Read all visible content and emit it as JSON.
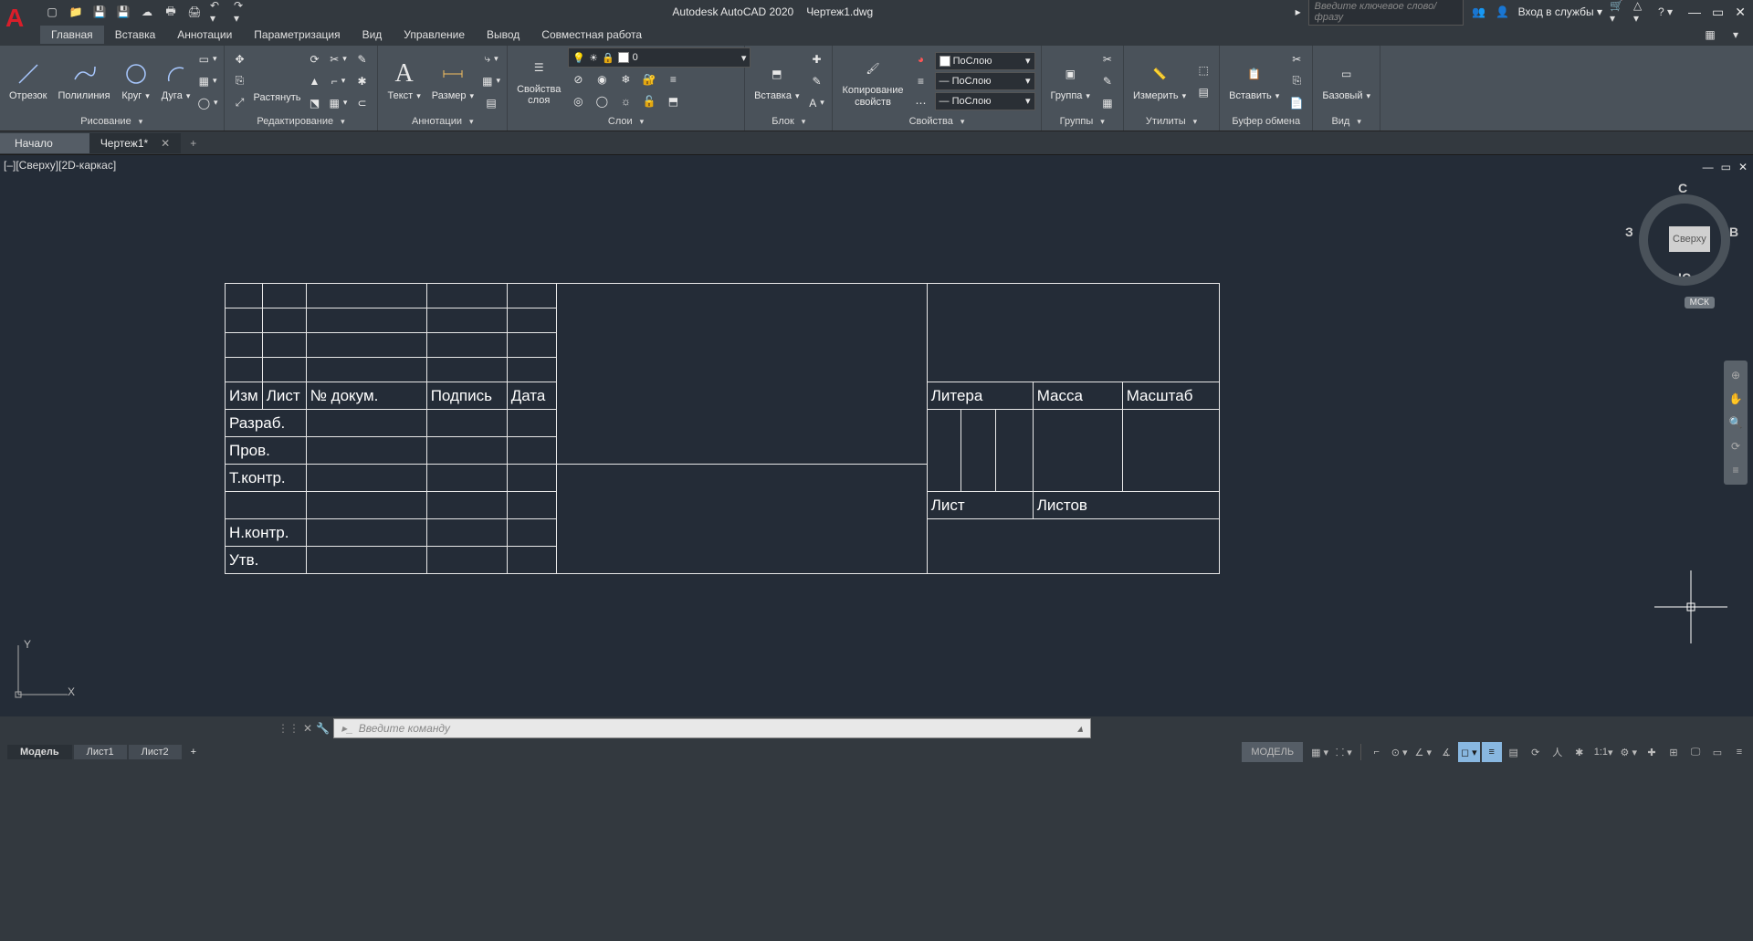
{
  "title": {
    "app": "Autodesk AutoCAD 2020",
    "file": "Чертеж1.dwg"
  },
  "search": {
    "placeholder": "Введите ключевое слово/фразу",
    "login": "Вход в службы"
  },
  "tabs": {
    "list": [
      "Главная",
      "Вставка",
      "Аннотации",
      "Параметризация",
      "Вид",
      "Управление",
      "Вывод",
      "Совместная работа"
    ],
    "active": 0
  },
  "ribbon": {
    "draw": {
      "line": "Отрезок",
      "pline": "Полилиния",
      "circle": "Круг",
      "arc": "Дуга",
      "panel": "Рисование"
    },
    "edit": {
      "stretch": "Растянуть",
      "panel": "Редактирование"
    },
    "annot": {
      "text": "Текст",
      "dim": "Размер",
      "panel": "Аннотации"
    },
    "layers": {
      "props": "Свойства\nслоя",
      "value": "0",
      "panel": "Слои"
    },
    "block": {
      "insert": "Вставка",
      "panel": "Блок"
    },
    "props": {
      "copy": "Копирование\nсвойств",
      "bylayer": "ПоСлою",
      "panel": "Свойства"
    },
    "groups": {
      "group": "Группа",
      "panel": "Группы"
    },
    "utils": {
      "measure": "Измерить",
      "panel": "Утилиты"
    },
    "clip": {
      "paste": "Вставить",
      "panel": "Буфер обмена"
    },
    "view": {
      "base": "Базовый",
      "panel": "Вид"
    }
  },
  "file_tabs": {
    "start": "Начало",
    "file": "Чертеж1*"
  },
  "viewport": {
    "label": "[–][Сверху][2D-каркас]"
  },
  "viewcube": {
    "top": "Сверху",
    "n": "С",
    "s": "Ю",
    "e": "В",
    "w": "З",
    "wcs": "МСК"
  },
  "table": {
    "headers": {
      "izm": "Изм",
      "list": "Лист",
      "docno": "№ докум.",
      "sign": "Подпись",
      "date": "Дата"
    },
    "rows": {
      "dev": "Разраб.",
      "check": "Пров.",
      "tcontrol": "Т.контр.",
      "ncontrol": "Н.контр.",
      "approve": "Утв."
    },
    "cols": {
      "litera": "Литера",
      "massa": "Масса",
      "scale": "Масштаб",
      "sheet": "Лист",
      "sheets": "Листов"
    }
  },
  "cmd": {
    "placeholder": "Введите команду"
  },
  "status": {
    "model": "Модель",
    "layouts": [
      "МОДЕЛЬ"
    ],
    "tabs": [
      "Лист1",
      "Лист2"
    ],
    "scale": "1:1"
  },
  "ucs": {
    "x": "X",
    "y": "Y"
  }
}
